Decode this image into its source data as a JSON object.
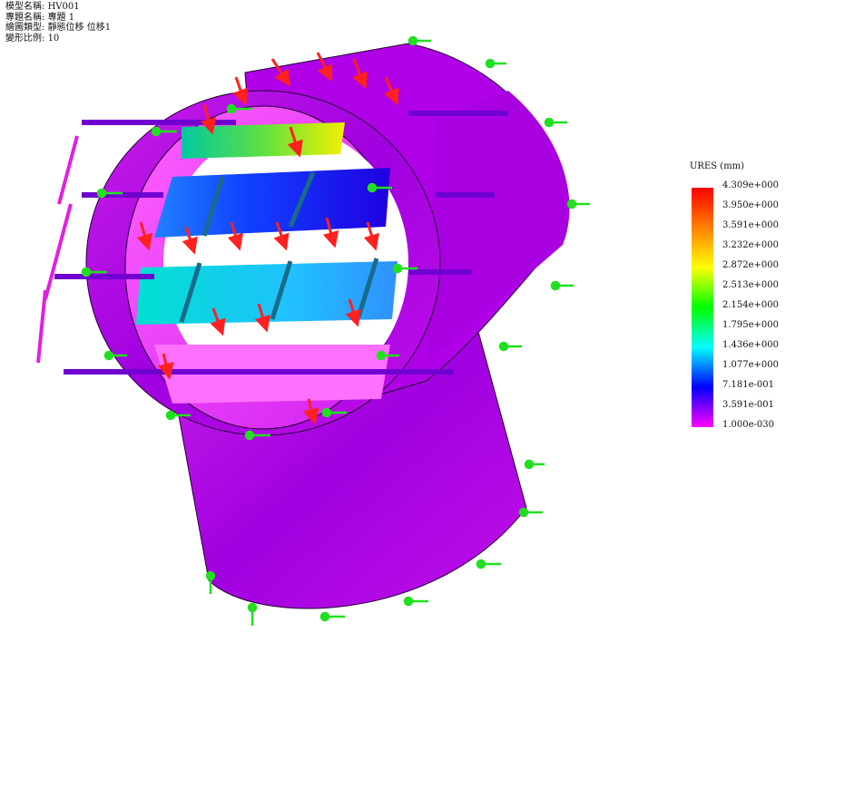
{
  "header": {
    "model_name_label": "模型名稱:",
    "model_name": "HV001",
    "study_name_label": "專題名稱:",
    "study_name": "專題 1",
    "plot_type_label": "繪圖類型:",
    "plot_type": "靜態位移 位移1",
    "deform_scale_label": "變形比例:",
    "deform_scale": "10"
  },
  "legend": {
    "title": "URES (mm)",
    "ticks": [
      "4.309e+000",
      "3.950e+000",
      "3.591e+000",
      "3.232e+000",
      "2.872e+000",
      "2.513e+000",
      "2.154e+000",
      "1.795e+000",
      "1.436e+000",
      "1.077e+000",
      "7.181e-001",
      "3.591e-001",
      "1.000e-030"
    ],
    "colors": [
      "#ff0000",
      "#ff8000",
      "#ffff00",
      "#00ff00",
      "#00ffff",
      "#0000ff",
      "#ff00ff"
    ]
  }
}
